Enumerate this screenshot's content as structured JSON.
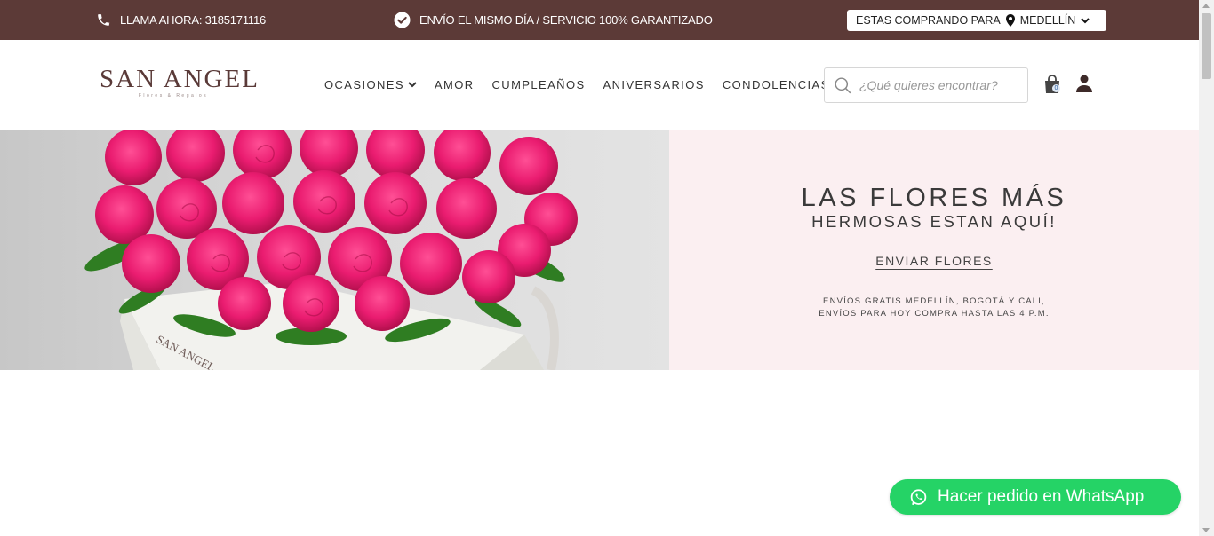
{
  "topbar": {
    "phone_text": "LLAMA AHORA: 3185171116",
    "shipping_text": "ENVÍO EL MISMO DÍA / SERVICIO 100% GARANTIZADO",
    "location_prefix": "ESTAS COMPRANDO PARA",
    "location_city": "MEDELLÍN",
    "background_color": "#5c3a37"
  },
  "header": {
    "logo_text": "SAN ANGEL",
    "logo_tagline": "Flores & Regalos",
    "nav": [
      "OCASIONES",
      "AMOR",
      "CUMPLEAÑOS",
      "ANIVERSARIOS",
      "CONDOLENCIAS"
    ],
    "search_placeholder": "¿Qué quieres encontrar?",
    "cart_count": "0"
  },
  "hero": {
    "title_line1": "LAS FLORES MÁS",
    "title_line2": "HERMOSAS ESTAN AQUÍ!",
    "cta_label": "ENVIAR FLORES",
    "note_line1": "ENVÍOS GRATIS MEDELLÍN, BOGOTÁ Y CALI,",
    "note_line2": "ENVÍOS PARA HOY COMPRA HASTA LAS 4 P.M.",
    "box_text": "SAN ANGEL",
    "panel_color": "#fbeff1"
  },
  "whatsapp": {
    "label": "Hacer pedido en WhatsApp",
    "color": "#25d366"
  },
  "icons": {
    "phone": "phone-icon",
    "check": "check-circle-icon",
    "pin": "map-pin-icon",
    "search": "search-icon",
    "cart": "shopping-bag-icon",
    "user": "user-icon",
    "whatsapp": "whatsapp-icon"
  }
}
